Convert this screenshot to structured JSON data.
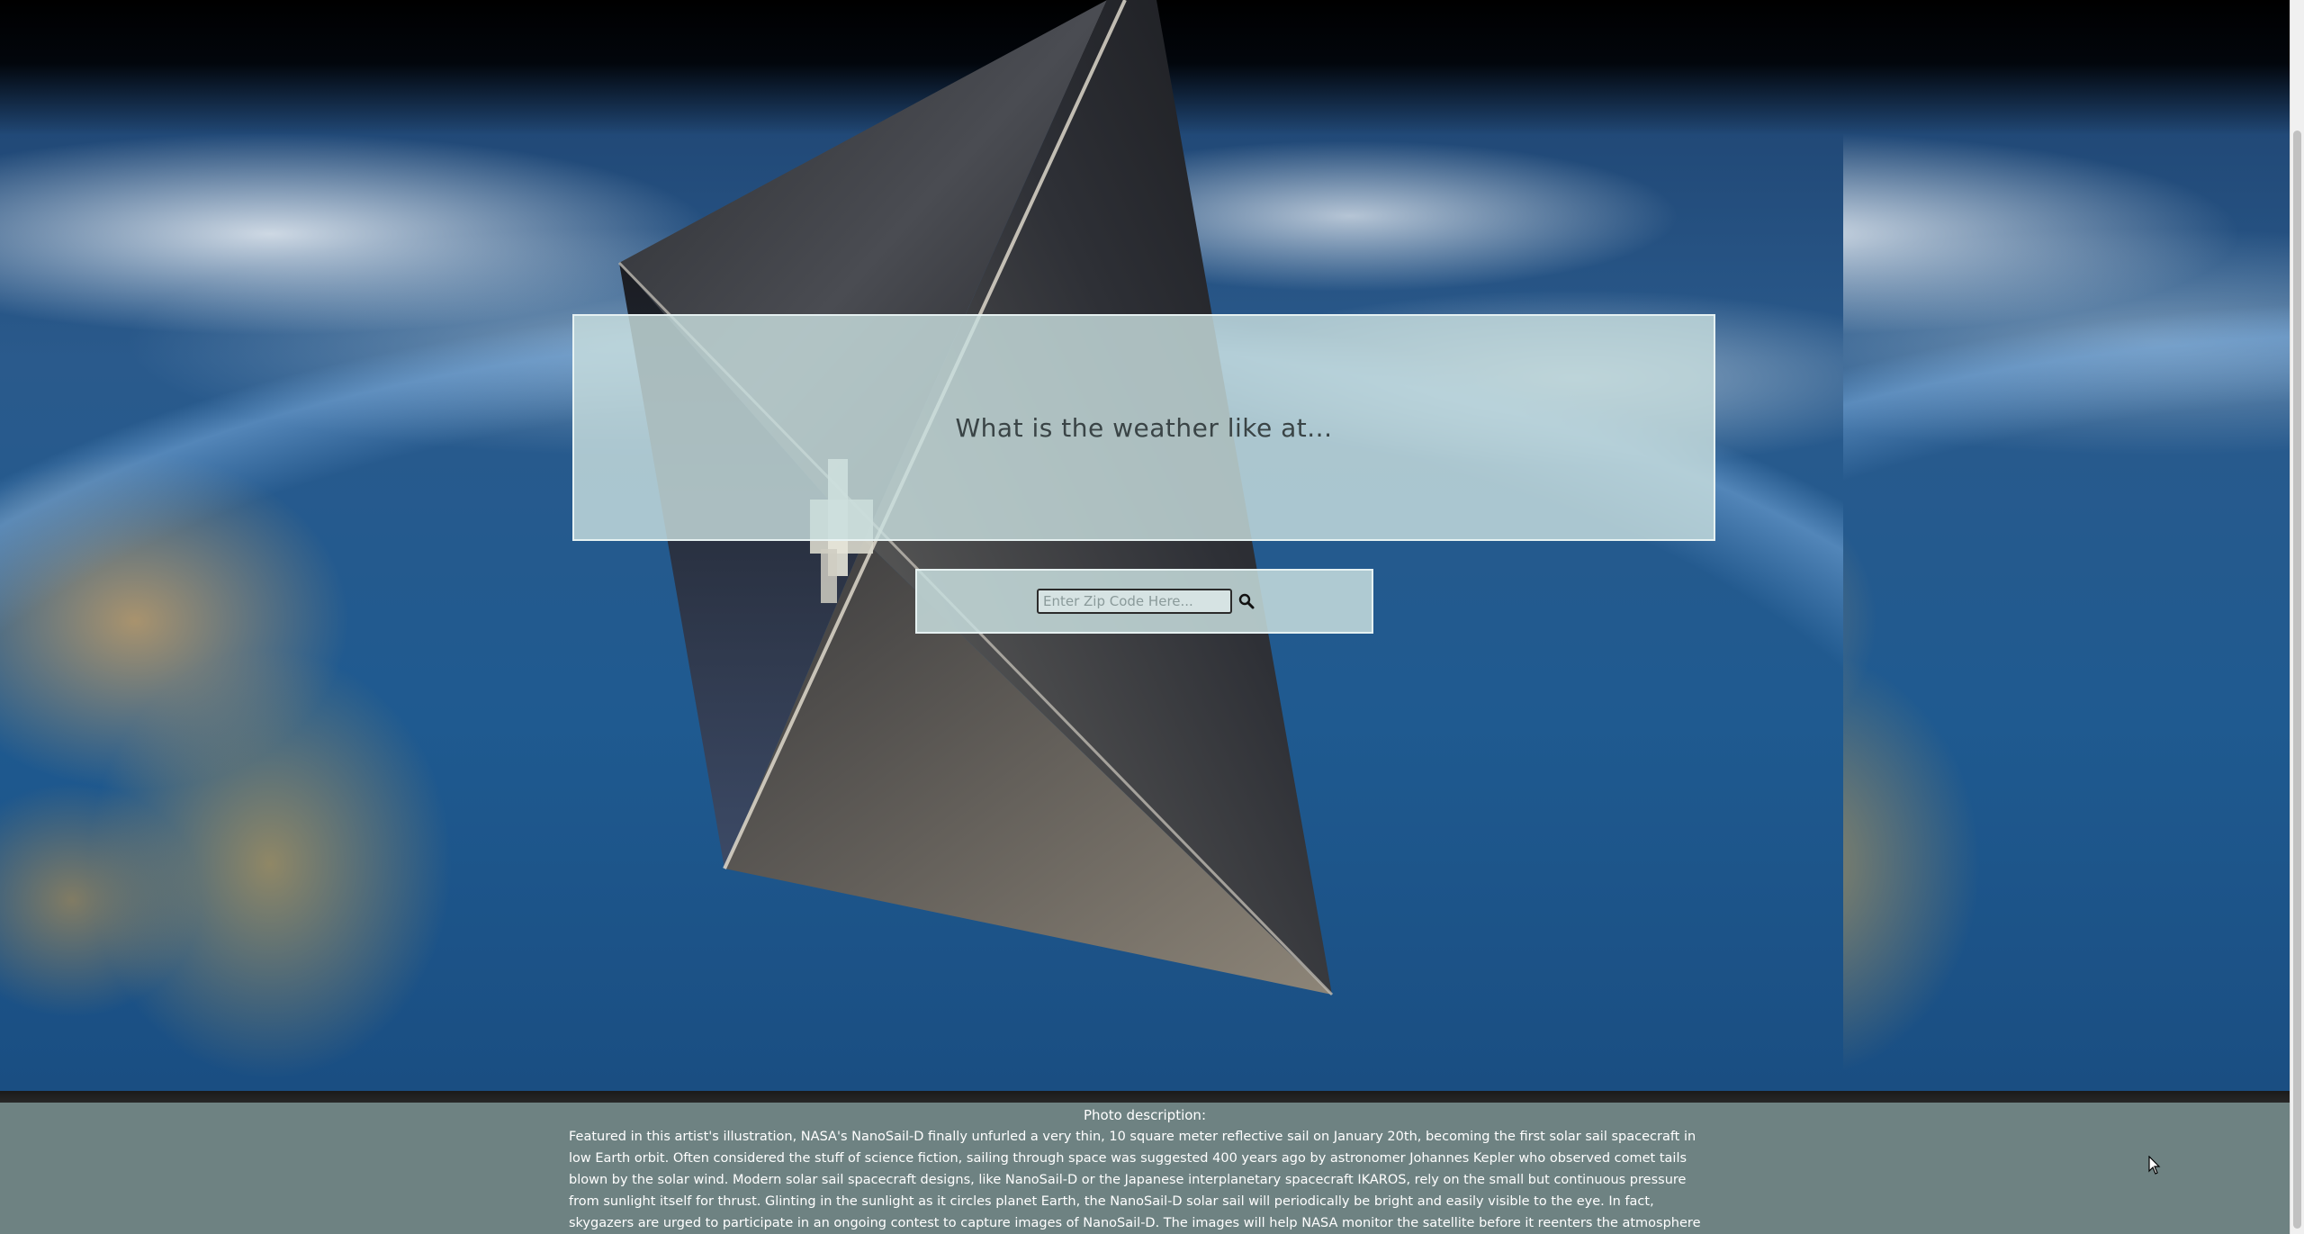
{
  "header": {
    "title": "What is the weather like at..."
  },
  "search": {
    "placeholder": "Enter Zip Code Here...",
    "value": "",
    "button_icon": "search-icon"
  },
  "photo": {
    "heading": "Photo description:",
    "description": "Featured in this artist's illustration, NASA's NanoSail-D finally unfurled a very thin, 10 square meter reflective sail on January 20th, becoming the first solar sail spacecraft in low Earth orbit. Often considered the stuff of science fiction, sailing through space was suggested 400 years ago by astronomer Johannes Kepler who observed comet tails blown by the solar wind. Modern solar sail spacecraft designs, like NanoSail-D or the Japanese interplanetary spacecraft IKAROS, rely on the small but continuous pressure from sunlight itself for thrust. Glinting in the sunlight as it circles planet Earth, the NanoSail-D solar sail will periodically be bright and easily visible to the eye. In fact, skygazers are urged to participate in an ongoing contest to capture images of NanoSail-D. The images will help NASA monitor the satellite before it reenters the atmosphere in April or May."
  },
  "colors": {
    "panel": "#c8dede",
    "footer": "#6e8282",
    "title_text": "#3a4446",
    "footer_text": "#ffffff"
  }
}
